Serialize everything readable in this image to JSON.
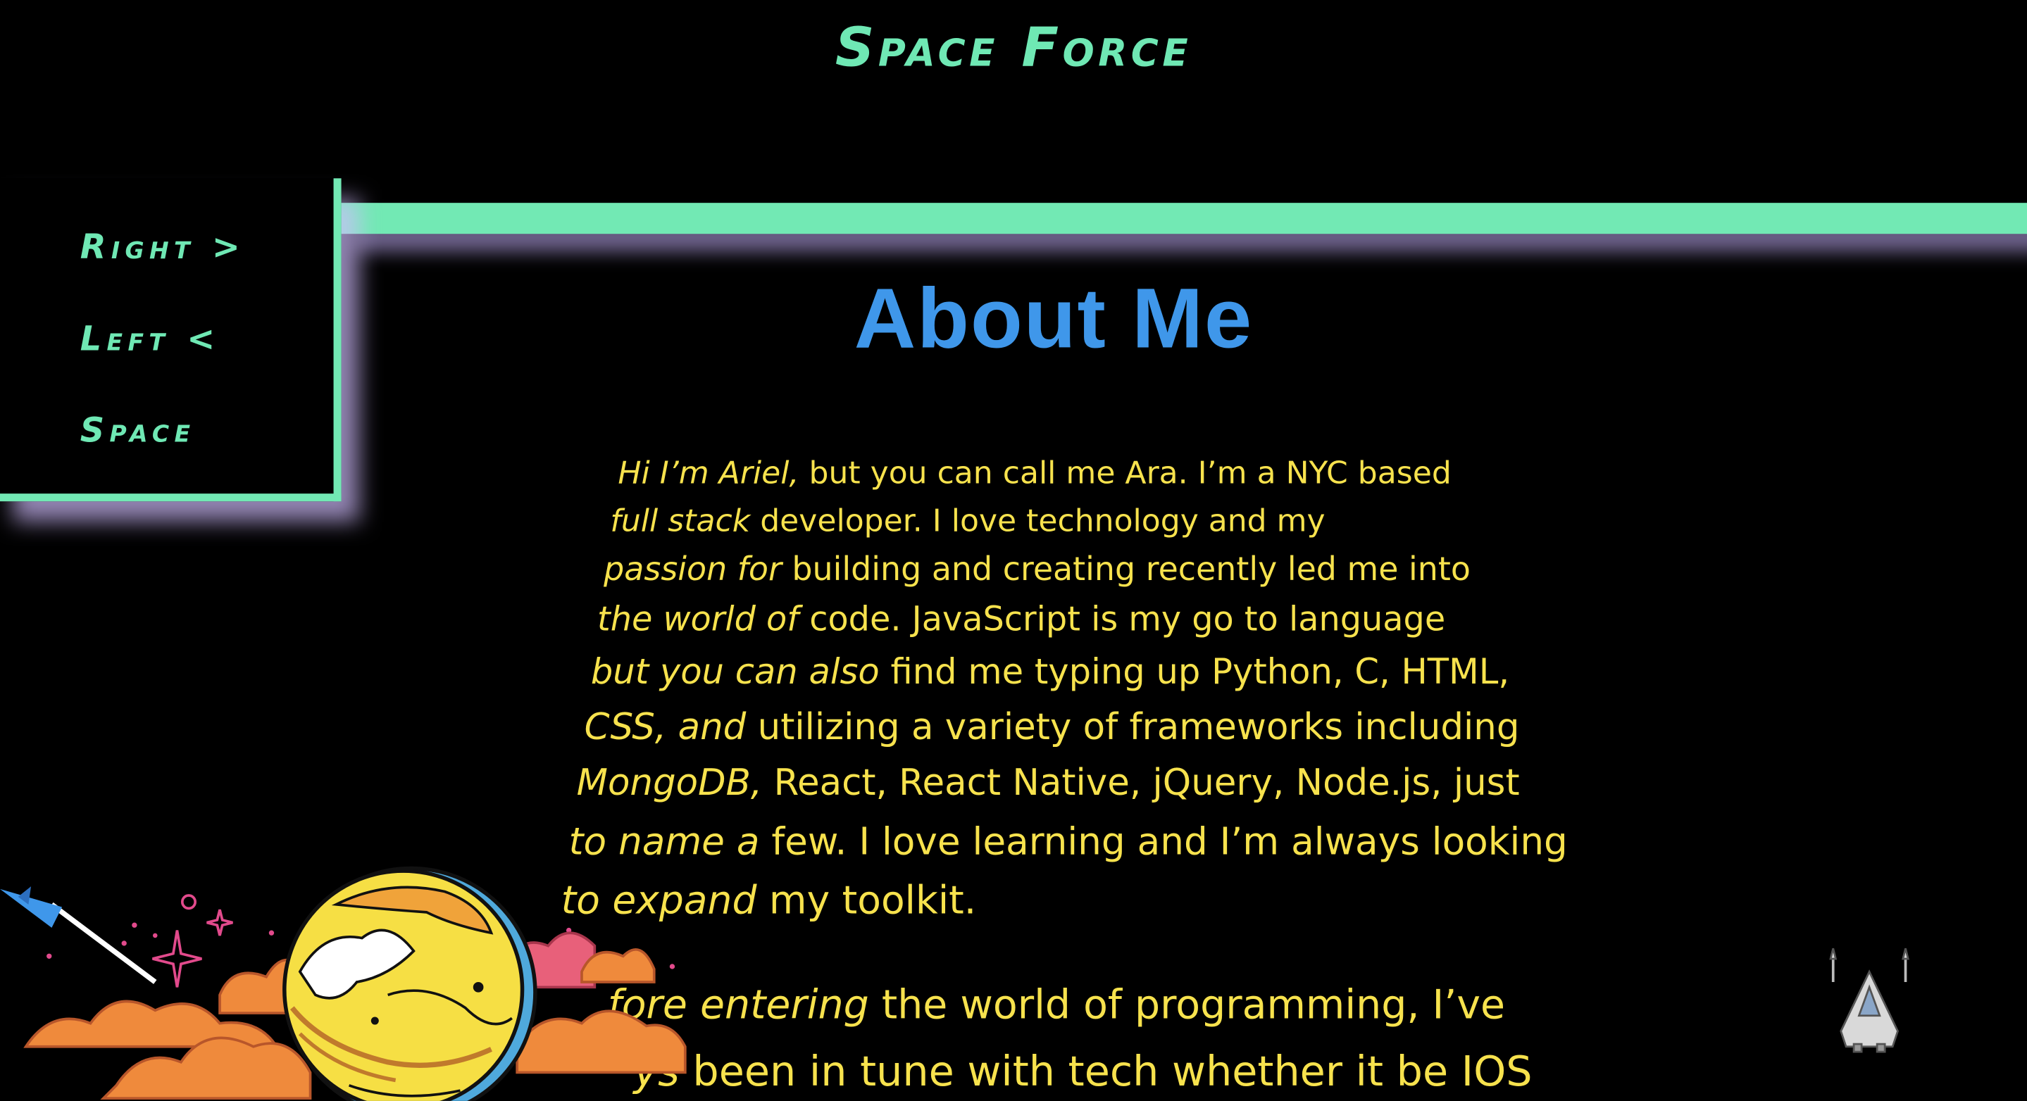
{
  "site": {
    "title": "Space Force"
  },
  "nav": {
    "items": [
      {
        "label": "Right >"
      },
      {
        "label": "Left <"
      },
      {
        "label": "Space"
      }
    ]
  },
  "about": {
    "heading": "About Me",
    "lines": [
      {
        "em": "Hi I’m Ariel,",
        "rest": " but you can call me Ara. I’m a NYC based"
      },
      {
        "em": "full stack",
        "rest": " developer. I love technology and my"
      },
      {
        "em": "passion for",
        "rest": " building and creating recently led me into"
      },
      {
        "em": "the world of",
        "rest": " code. JavaScript is my go to language"
      },
      {
        "em": "but you can also",
        "rest": " find me typing up Python, C, HTML,"
      },
      {
        "em": "CSS, and",
        "rest": " utilizing a variety of frameworks including"
      },
      {
        "em": "MongoDB,",
        "rest": " React, React Native, jQuery, Node.js, just"
      },
      {
        "em": "to name a",
        "rest": " few. I love learning and I’m always looking"
      },
      {
        "em": "to expand",
        "rest": " my toolkit."
      },
      {
        "em": "fore entering",
        "rest": " the world of programming, I’ve"
      },
      {
        "em": "ys",
        "rest": " been in tune with tech whether it be IOS"
      }
    ]
  },
  "colors": {
    "accent_green": "#72e9b4",
    "heading_blue": "#3f97ea",
    "text_yellow": "#f7e24d",
    "background": "#000000"
  },
  "icons": {
    "planet": "planet-illustration",
    "ship": "spaceship-icon",
    "rocket": "rocket-icon"
  }
}
